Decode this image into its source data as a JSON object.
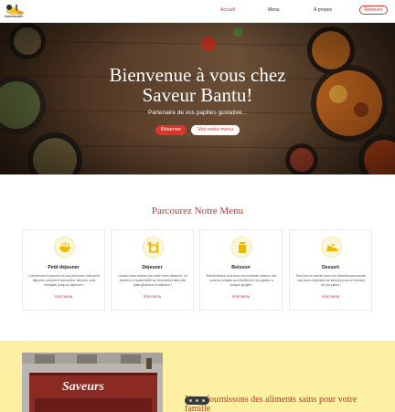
{
  "header": {
    "logo_text": "SAVEUR BANTU",
    "nav": [
      {
        "label": "Accueil",
        "active": true
      },
      {
        "label": "Menu",
        "active": false
      },
      {
        "label": "À propos",
        "active": false
      }
    ],
    "reserve_label": "Réserver"
  },
  "hero": {
    "title_line1": "Bienvenue à vous chez",
    "title_line2": "Saveur Bantu!",
    "subtitle": "Partenaire de vos papilles gustative...",
    "btn_reserve": "Réserver",
    "btn_menu": "Voir notre menu"
  },
  "menu_section": {
    "title": "Parcourez Notre Menu",
    "cards": [
      {
        "icon": "bowl-icon",
        "title": "Petit déjeuner",
        "desc": "Commencez la journée du bon pied avec notre petit déjeuner complet et savoureux, fait pour vous energiser jusqu'au déjeuner !",
        "link": "Voir menu"
      },
      {
        "icon": "dinner-icon",
        "title": "Déjeuner",
        "desc": "Laissez vous séduire par notre menu déjeuner, où fraîcheur et authenticité se rencontrent dans des plats généreux et délicieux !",
        "link": "Voir menu"
      },
      {
        "icon": "drink-icon",
        "title": "Boisson",
        "desc": "Rafraîchissez vous avec nos cocktails maison, des saveurs uniques qui réveilleront vos papilles à chaque gorgée !",
        "link": "Voir menu"
      },
      {
        "icon": "cake-icon",
        "title": "Dessert",
        "desc": "Terminez en beauté avec nos desserts gourmands, une douce explosion de saveurs pour un moment de pur plaisir !",
        "link": "Voir menu"
      }
    ]
  },
  "about_section": {
    "sign_text": "Saveurs",
    "heading": "Nous fournissons des aliments sains pour votre famille"
  },
  "colors": {
    "accent": "#d9352b",
    "yellow": "#fdf0a3"
  }
}
